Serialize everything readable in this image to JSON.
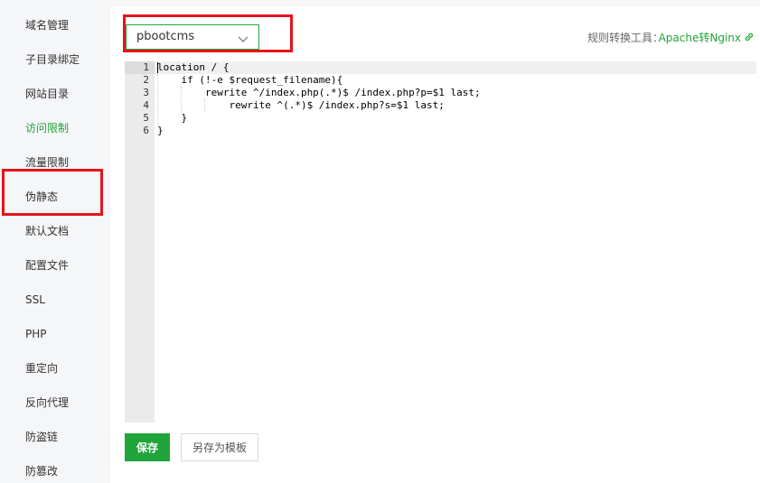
{
  "sidebar": {
    "items": [
      {
        "label": "域名管理"
      },
      {
        "label": "子目录绑定"
      },
      {
        "label": "网站目录"
      },
      {
        "label": "访问限制"
      },
      {
        "label": "流量限制"
      },
      {
        "label": "伪静态"
      },
      {
        "label": "默认文档"
      },
      {
        "label": "配置文件"
      },
      {
        "label": "SSL"
      },
      {
        "label": "PHP"
      },
      {
        "label": "重定向"
      },
      {
        "label": "反向代理"
      },
      {
        "label": "防盗链"
      },
      {
        "label": "防篡改"
      }
    ],
    "active_index": 3
  },
  "rewrite": {
    "selected_template": "pbootcms"
  },
  "tool": {
    "label": "规则转换工具：",
    "link": "Apache转Nginx"
  },
  "editor": {
    "lines": [
      {
        "num": "1",
        "text": "location / {"
      },
      {
        "num": "2",
        "text": "    if (!-e $request_filename){"
      },
      {
        "num": "3",
        "text": "        rewrite ^/index.php(.*)$ /index.php?p=$1 last;"
      },
      {
        "num": "4",
        "text": "            rewrite ^(.*)$ /index.php?s=$1 last;"
      },
      {
        "num": "5",
        "text": "    }"
      },
      {
        "num": "6",
        "text": "}"
      }
    ]
  },
  "actions": {
    "save_label": "保存",
    "save_as_template_label": "另存为模板"
  },
  "colors": {
    "accent": "#20a53a",
    "highlight_box": "#e5141b"
  },
  "icons": {
    "select": "chevron-down-icon",
    "tool_link": "link-icon"
  }
}
